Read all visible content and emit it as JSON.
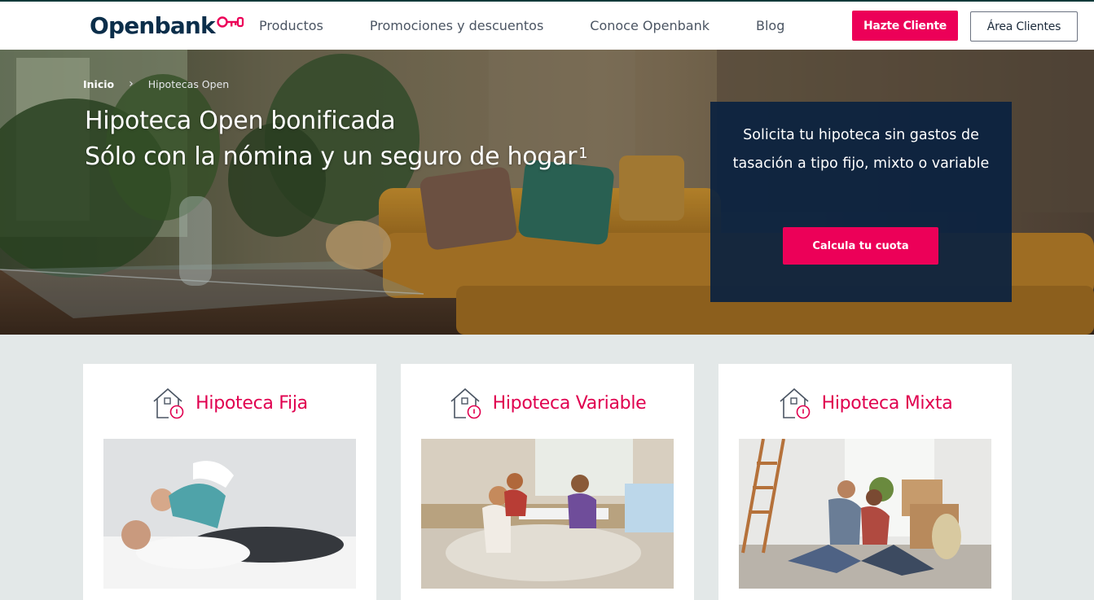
{
  "header": {
    "logo_text": "Openbank",
    "nav": [
      "Productos",
      "Promociones y descuentos",
      "Conoce Openbank",
      "Blog"
    ],
    "join_label": "Hazte Cliente",
    "area_label": "Área Clientes"
  },
  "hero": {
    "breadcrumb": {
      "home": "Inicio",
      "current": "Hipotecas Open"
    },
    "title_line1": "Hipoteca Open bonificada",
    "title_line2": "Sólo con la nómina y un seguro de hogar",
    "title_sup": "1",
    "cta_text": "Solicita tu hipoteca sin gastos de tasación a tipo fijo, mixto o variable",
    "cta_button": "Calcula tu cuota"
  },
  "cards": [
    {
      "title": "Hipoteca Fija",
      "icon": "house-icon"
    },
    {
      "title": "Hipoteca Variable",
      "icon": "house-icon"
    },
    {
      "title": "Hipoteca Mixta",
      "icon": "house-icon"
    }
  ],
  "colors": {
    "brand": "#ec0058",
    "navy": "#0a2240",
    "logo": "#0b2e4a",
    "band": "#e3e8e8"
  }
}
